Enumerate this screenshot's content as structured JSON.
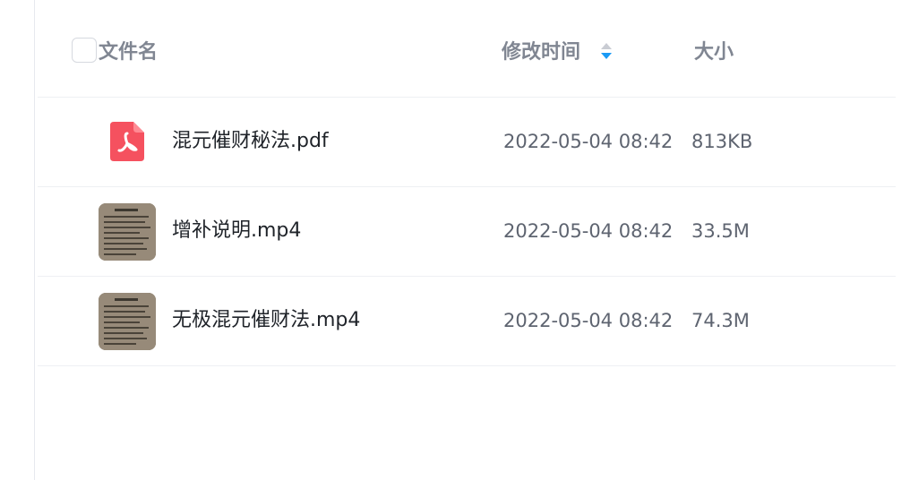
{
  "header": {
    "name_label": "文件名",
    "time_label": "修改时间",
    "size_label": "大小"
  },
  "files": [
    {
      "name": "混元催财秘法.pdf",
      "date": "2022-05-04 08:42",
      "size": "813KB",
      "icon": "pdf-icon"
    },
    {
      "name": "增补说明.mp4",
      "date": "2022-05-04 08:42",
      "size": "33.5M",
      "icon": "video-thumbnail"
    },
    {
      "name": "无极混元催财法.mp4",
      "date": "2022-05-04 08:42",
      "size": "74.3M",
      "icon": "video-thumbnail"
    }
  ],
  "colors": {
    "pdf": "#f5515f",
    "sort_active": "#1a9af5",
    "header_text": "#808692"
  }
}
